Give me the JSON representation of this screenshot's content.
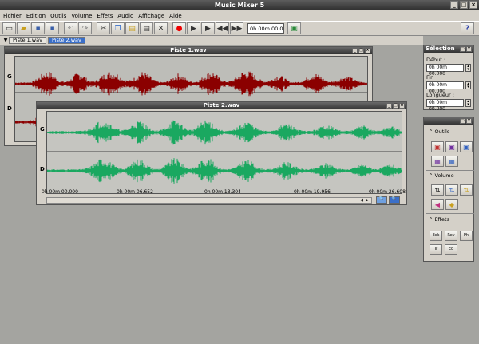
{
  "app": {
    "title": "Music Mixer 5"
  },
  "menu": [
    "Fichier",
    "Edition",
    "Outils",
    "Volume",
    "Effets",
    "Audio",
    "Affichage",
    "Aide"
  ],
  "toolbar": {
    "time": "0h 00m 00.000"
  },
  "tabs": [
    "Piste 1.wav",
    "Piste 2.wav"
  ],
  "track1": {
    "title": "Piste 1.wav",
    "left": "G",
    "right": "D",
    "color": "#8b0000"
  },
  "track2": {
    "title": "Piste 2.wav",
    "left": "G",
    "right": "D",
    "color": "#1aa860",
    "ruler": [
      "0h 00m 00.000",
      "0h 00m 06.652",
      "0h 00m 13.304",
      "0h 00m 19.956",
      "0h 00m 26.608"
    ]
  },
  "selection": {
    "title": "Sélection",
    "start_label": "Début :",
    "start": "0h 00m 00.000",
    "end_label": "Fin",
    "end": "0h 00m 00.000",
    "length_label": "Longueur :",
    "length": "0h 00m 00.000"
  },
  "tools": {
    "outils": "Outils",
    "volume": "Volume",
    "effets": "Effets",
    "fx": [
      "Eck",
      "Rev",
      "Ph",
      "Tr",
      "Eq"
    ]
  }
}
